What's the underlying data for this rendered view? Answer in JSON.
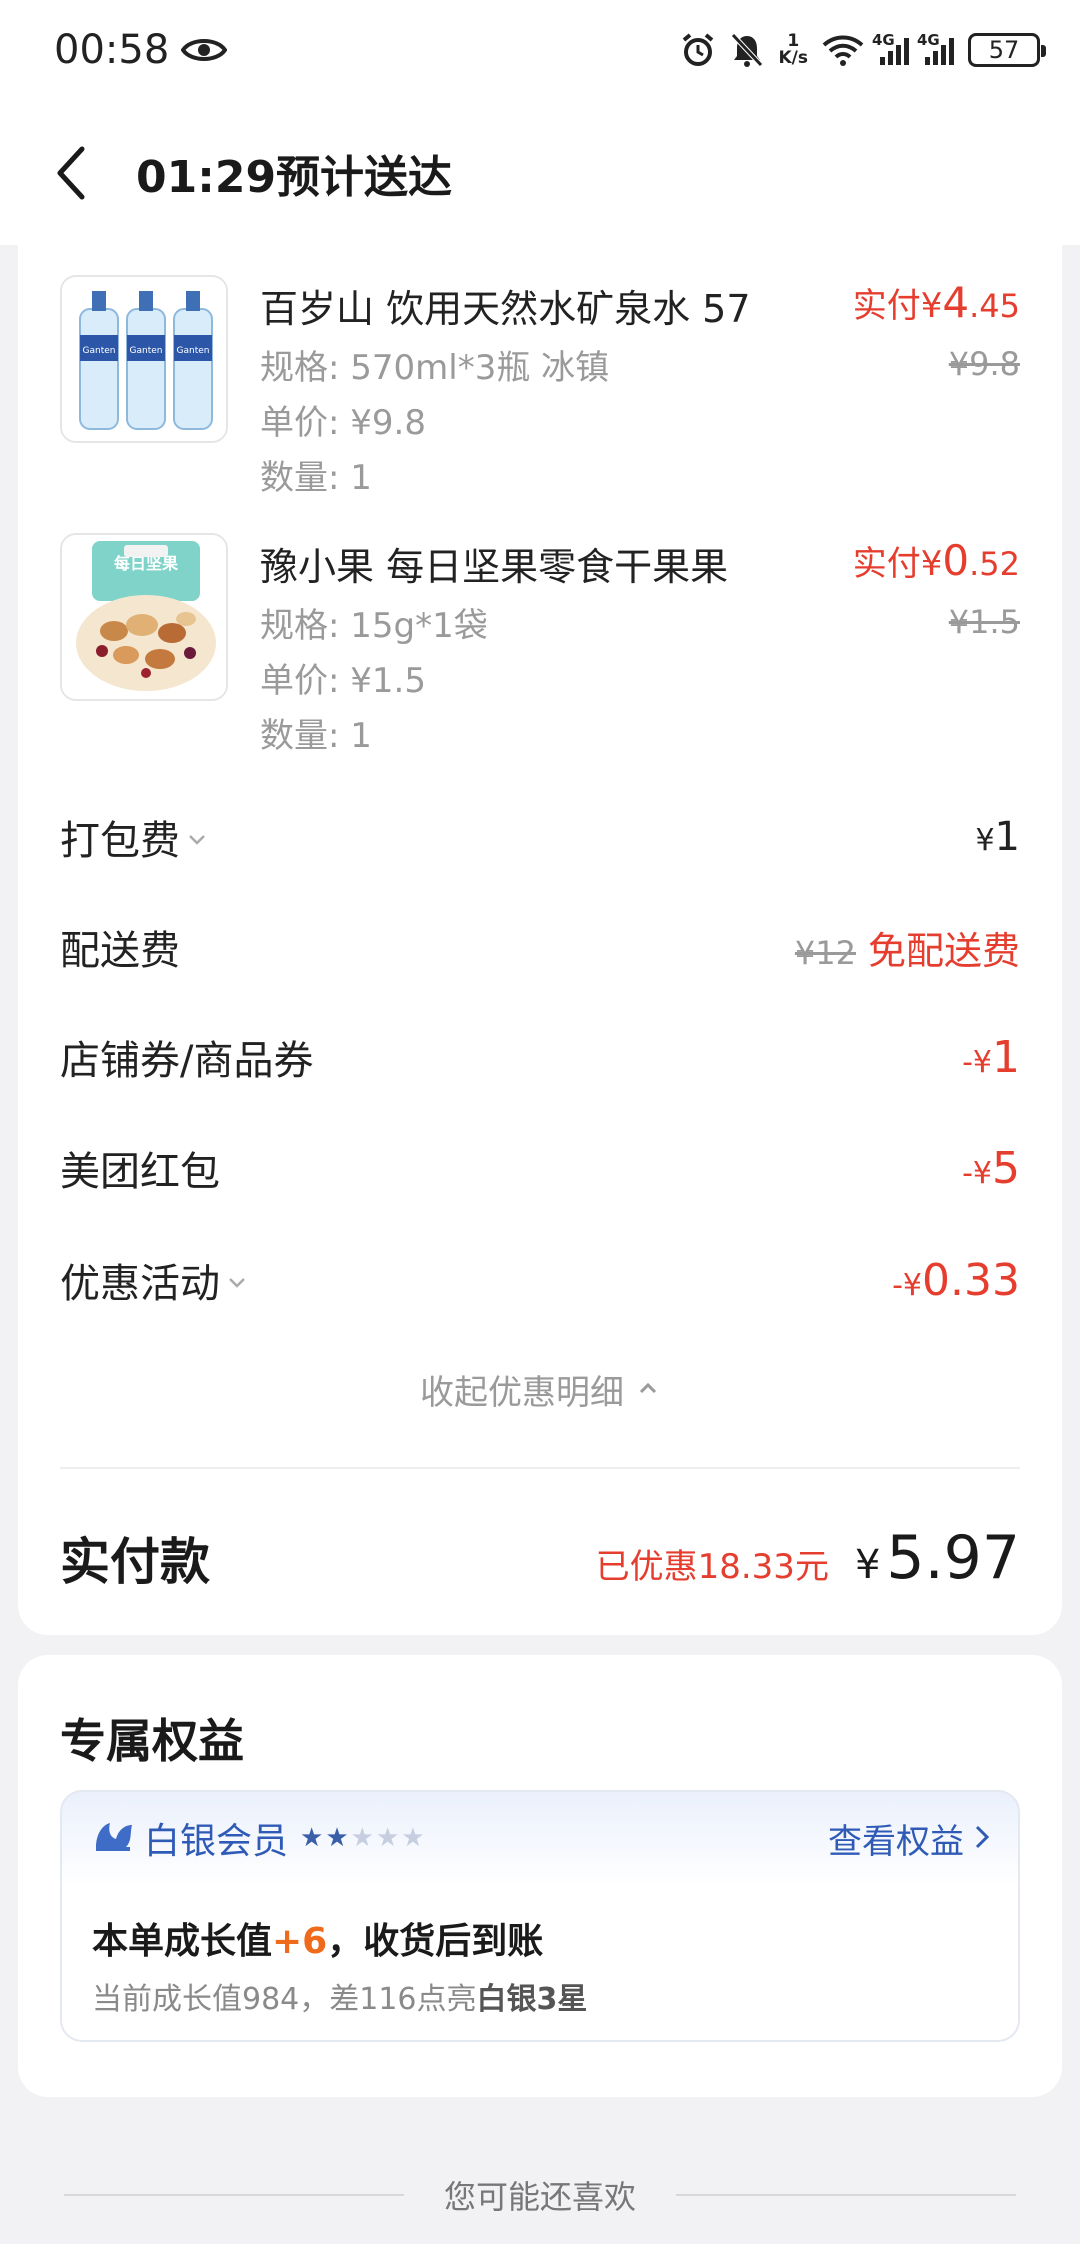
{
  "status_bar": {
    "time": "00:58",
    "net_speed_value": "1",
    "net_speed_unit": "K/s",
    "signal1_label": "4G",
    "signal2_label": "4G",
    "battery": "57"
  },
  "header": {
    "title": "01:29预计送达"
  },
  "items": [
    {
      "name": "百岁山 饮用天然水矿泉水 57",
      "spec": "规格: 570ml*3瓶 冰镇",
      "unit_price": "单价: ¥9.8",
      "quantity": "数量: 1",
      "paid_prefix": "实付¥",
      "paid_int": "4",
      "paid_dec": ".45",
      "original": "¥9.8"
    },
    {
      "name": "豫小果 每日坚果零食干果果",
      "spec": "规格: 15g*1袋",
      "unit_price": "单价: ¥1.5",
      "quantity": "数量: 1",
      "paid_prefix": "实付¥",
      "paid_int": "0",
      "paid_dec": ".52",
      "original": "¥1.5",
      "package_text": "每日坚果"
    }
  ],
  "fees": {
    "packing_label": "打包费",
    "packing_yen": "¥",
    "packing_value": "1",
    "delivery_label": "配送费",
    "delivery_original": "¥12",
    "delivery_value": "免配送费",
    "store_coupon_label": "店铺券/商品券",
    "store_coupon_prefix": "-¥",
    "store_coupon_value": "1",
    "red_packet_label": "美团红包",
    "red_packet_prefix": "-¥",
    "red_packet_value": "5",
    "promo_label": "优惠活动",
    "promo_prefix": "-¥",
    "promo_value": "0.33"
  },
  "collapse_label": "收起优惠明细",
  "total": {
    "label": "实付款",
    "saved": "已优惠18.33元",
    "yen": "¥",
    "amount": "5.97"
  },
  "benefits": {
    "title": "专属权益",
    "member_level": "白银会员",
    "stars_total": 5,
    "stars_on": 2,
    "view_label": "查看权益",
    "growth_prefix": "本单成长值",
    "growth_plus": "+6",
    "growth_suffix": "，收货后到账",
    "growth_sub_prefix": "当前成长值984，差116点亮",
    "growth_sub_bold": "白银3星"
  },
  "recommend_label": "您可能还喜欢",
  "colors": {
    "accent_red": "#e53e2f",
    "link_blue": "#2f5bb7",
    "orange": "#f06a1c"
  }
}
